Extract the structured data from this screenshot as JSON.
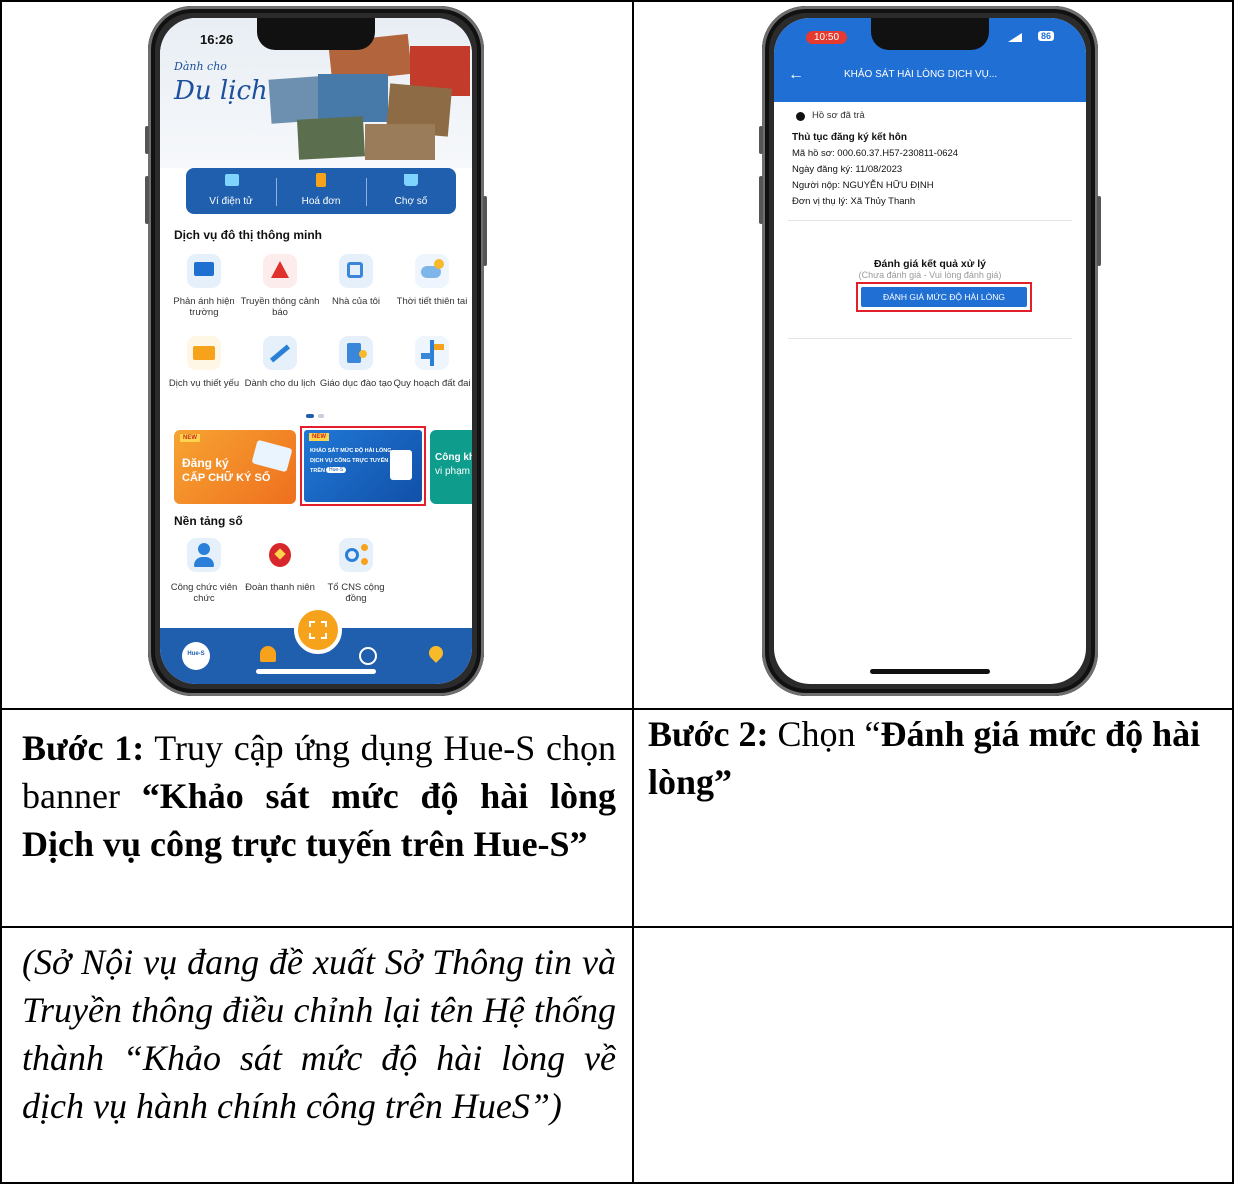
{
  "phone1": {
    "time": "16:26",
    "hero_small": "Dành cho",
    "hero_big": "Du lịch",
    "quick_actions": [
      "Ví điện tử",
      "Hoá đơn",
      "Chợ số"
    ],
    "section_smart": "Dịch vụ đô thị thông minh",
    "smart_services": [
      "Phản ánh hiện trường",
      "Truyền thông cảnh báo",
      "Nhà của tôi",
      "Thời tiết thiên tai",
      "Dịch vụ thiết yếu",
      "Dành cho du lịch",
      "Giáo dục đào tạo",
      "Quy hoạch đất đai"
    ],
    "banner1_new": "NEW",
    "banner1_line1": "Đăng ký",
    "banner1_line2": "CẤP CHỮ KÝ SỐ",
    "banner2_new": "NEW",
    "banner2_line1": "KHẢO SÁT MỨC ĐỘ HÀI LÒNG",
    "banner2_line2": "DỊCH VỤ CÔNG TRỰC TUYẾN",
    "banner2_line3": "TRÊN",
    "banner2_badge": "Hue-S",
    "banner3_line1": "Công khai",
    "banner3_line2": "vi phạm g",
    "section_platform": "Nền tảng số",
    "platform_services": [
      "Công chức viên chức",
      "Đoàn thanh niên",
      "Tổ CNS cộng đồng"
    ],
    "tab_logo": "Hue-S"
  },
  "phone2": {
    "time": "10:50",
    "battery": "86",
    "header_title": "KHẢO SÁT HÀI LÒNG DỊCH VỤ...",
    "status": "Hồ sơ đã trả",
    "procedure": "Thủ tục đăng ký kết hôn",
    "record_no": "Mã hồ sơ: 000.60.37.H57-230811-0624",
    "date": "Ngày đăng ký: 11/08/2023",
    "submitter": "Người nộp: NGUYỄN HỮU ĐỊNH",
    "unit": "Đơn vị thụ lý: Xã Thủy Thanh",
    "eval_title": "Đánh giá kết quả xử lý",
    "eval_sub": "(Chưa đánh giá - Vui lòng đánh giá)",
    "eval_button": "ĐÁNH GIÁ MỨC ĐỘ HÀI LÒNG"
  },
  "step1": {
    "label": "Bước 1:",
    "text": "Truy cập ứng dụng Hue-S chọn banner",
    "bold": "“Khảo sát mức độ hài lòng Dịch vụ công trực tuyến trên Hue-S”"
  },
  "step2": {
    "label": "Bước 2:",
    "text": "Chọn “",
    "bold": "Đánh giá mức độ hài lòng”"
  },
  "note": "(Sở Nội vụ đang đề xuất Sở Thông tin và Truyền thông điều chỉnh lại tên Hệ thống thành “Khảo sát mức độ hài lòng về dịch vụ hành chính công trên HueS”)"
}
